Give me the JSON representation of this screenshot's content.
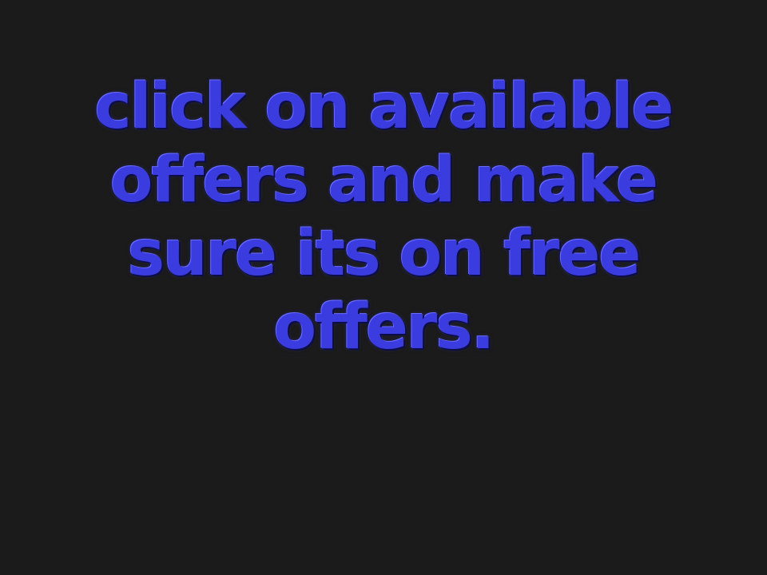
{
  "caption": {
    "lines": [
      "click on available",
      "offers and make",
      "sure its on free",
      "offers."
    ]
  },
  "colors": {
    "background": "#1b1b1b",
    "text": "#3a3ce0"
  }
}
